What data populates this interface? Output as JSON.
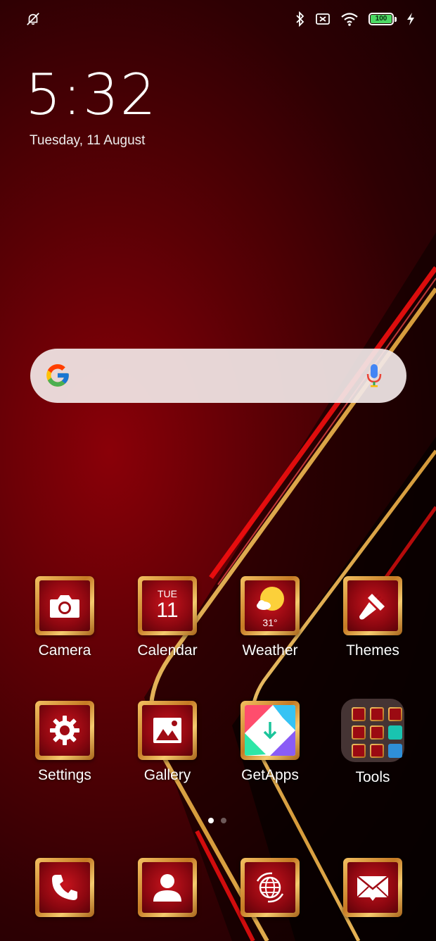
{
  "status_bar": {
    "left_icon": "notifications-muted-icon",
    "right_icons": [
      "bluetooth-icon",
      "no-sim-icon",
      "wifi-icon"
    ],
    "battery_level": "100",
    "charging_icon": "bolt-icon"
  },
  "lockclock": {
    "time": "5:32",
    "date": "Tuesday, 11 August"
  },
  "search": {
    "logo": "google-g-icon",
    "mic": "microphone-icon"
  },
  "apps": {
    "camera": "Camera",
    "calendar": "Calendar",
    "calendar_day": "TUE",
    "calendar_date": "11",
    "weather": "Weather",
    "weather_temp": "31°",
    "themes": "Themes",
    "settings": "Settings",
    "gallery": "Gallery",
    "getapps": "GetApps",
    "tools": "Tools"
  },
  "dock": {
    "items": [
      "phone-icon",
      "contacts-icon",
      "browser-icon",
      "messages-icon"
    ]
  },
  "pages": {
    "current": 1,
    "total": 2
  },
  "colors": {
    "accent_gold": "#f3c061",
    "tile_red": "#9b0a12",
    "battery_green": "#4cd964"
  }
}
